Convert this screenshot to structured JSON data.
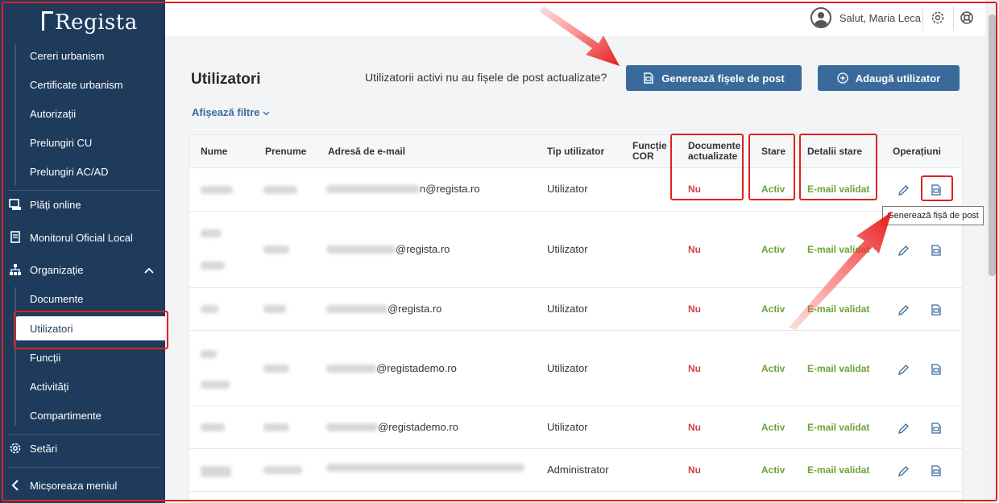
{
  "brand": {
    "name": "Regista"
  },
  "sidebar": {
    "top_sub_items": [
      "Cereri urbanism",
      "Certificate urbanism",
      "Autorizații",
      "Prelungiri CU",
      "Prelungiri AC/AD"
    ],
    "plati": "Plăți online",
    "monitor": "Monitorul Oficial Local",
    "organizatie": "Organizație",
    "org_items": [
      "Documente",
      "Utilizatori",
      "Funcții",
      "Activități",
      "Compartimente"
    ],
    "setari": "Setări",
    "collapse": "Micșoreaza meniul"
  },
  "header": {
    "greeting": "Salut, Maria Leca"
  },
  "page": {
    "title": "Utilizatori",
    "notice": "Utilizatorii activi nu au fișele de post actualizate?",
    "generate_button": "Generează fișele de post",
    "add_button": "Adaugă utilizator",
    "filters_link": "Afișează filtre"
  },
  "table": {
    "columns": {
      "nume": "Nume",
      "prenume": "Prenume",
      "email": "Adresă de e-mail",
      "tip": "Tip utilizator",
      "functie_1": "Funcție",
      "functie_2": "COR",
      "docs_1": "Documente",
      "docs_2": "actualizate",
      "stare": "Stare",
      "detalii": "Detalii stare",
      "operatiuni": "Operațiuni"
    },
    "rows": [
      {
        "email_domain": "n@regista.ro",
        "tip": "Utilizator",
        "docs": "Nu",
        "stare": "Activ",
        "detalii": "E-mail validat"
      },
      {
        "email_domain": "@regista.ro",
        "tip": "Utilizator",
        "docs": "Nu",
        "stare": "Activ",
        "detalii": "E-mail validat"
      },
      {
        "email_domain": "@regista.ro",
        "tip": "Utilizator",
        "docs": "Nu",
        "stare": "Activ",
        "detalii": "E-mail validat"
      },
      {
        "email_domain": "@registademo.ro",
        "tip": "Utilizator",
        "docs": "Nu",
        "stare": "Activ",
        "detalii": "E-mail validat"
      },
      {
        "email_domain": "@registademo.ro",
        "tip": "Utilizator",
        "docs": "Nu",
        "stare": "Activ",
        "detalii": "E-mail validat"
      },
      {
        "email_domain": "",
        "tip": "Administrator",
        "docs": "Nu",
        "stare": "Activ",
        "detalii": "E-mail validat"
      }
    ]
  },
  "tooltip": "Generează fișă de post",
  "colors": {
    "sidebar": "#1f3b5c",
    "primary": "#3a6a9b",
    "no": "#c94747",
    "ok": "#6aa336",
    "annotation": "#e02020"
  }
}
